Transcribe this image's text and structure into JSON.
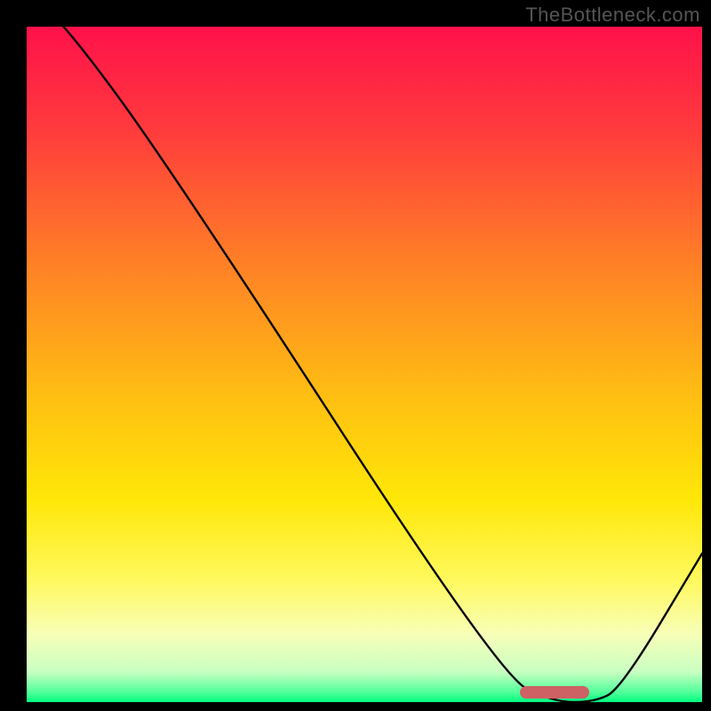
{
  "watermark": "TheBottleneck.com",
  "colors": {
    "frame_bg": "#000000",
    "marker": "#cd6164",
    "curve": "#000000",
    "gradient_stops": [
      {
        "offset": 0.0,
        "color": "#ff114a"
      },
      {
        "offset": 0.15,
        "color": "#ff3a3d"
      },
      {
        "offset": 0.35,
        "color": "#ff8026"
      },
      {
        "offset": 0.55,
        "color": "#ffbf12"
      },
      {
        "offset": 0.7,
        "color": "#ffe708"
      },
      {
        "offset": 0.82,
        "color": "#fff95e"
      },
      {
        "offset": 0.9,
        "color": "#f7ffb8"
      },
      {
        "offset": 0.955,
        "color": "#c9ffc2"
      },
      {
        "offset": 0.985,
        "color": "#52ff9a"
      },
      {
        "offset": 1.0,
        "color": "#00ff7f"
      }
    ]
  },
  "chart_data": {
    "type": "line",
    "title": "",
    "xlabel": "",
    "ylabel": "",
    "xlim": [
      0,
      100
    ],
    "ylim": [
      0,
      100
    ],
    "x": [
      0,
      6,
      22,
      70,
      78,
      84,
      88,
      100
    ],
    "values": [
      105,
      100,
      78,
      4,
      0,
      0,
      2,
      22
    ],
    "marker_range_x": [
      73,
      83.3
    ],
    "note": "Values are estimated from pixel positions; y=0 is the bottom of the colored area. The curve enters from top-left, kinks near x≈22, descends to a flat minimum over x≈78–84, then rises toward the right edge."
  }
}
